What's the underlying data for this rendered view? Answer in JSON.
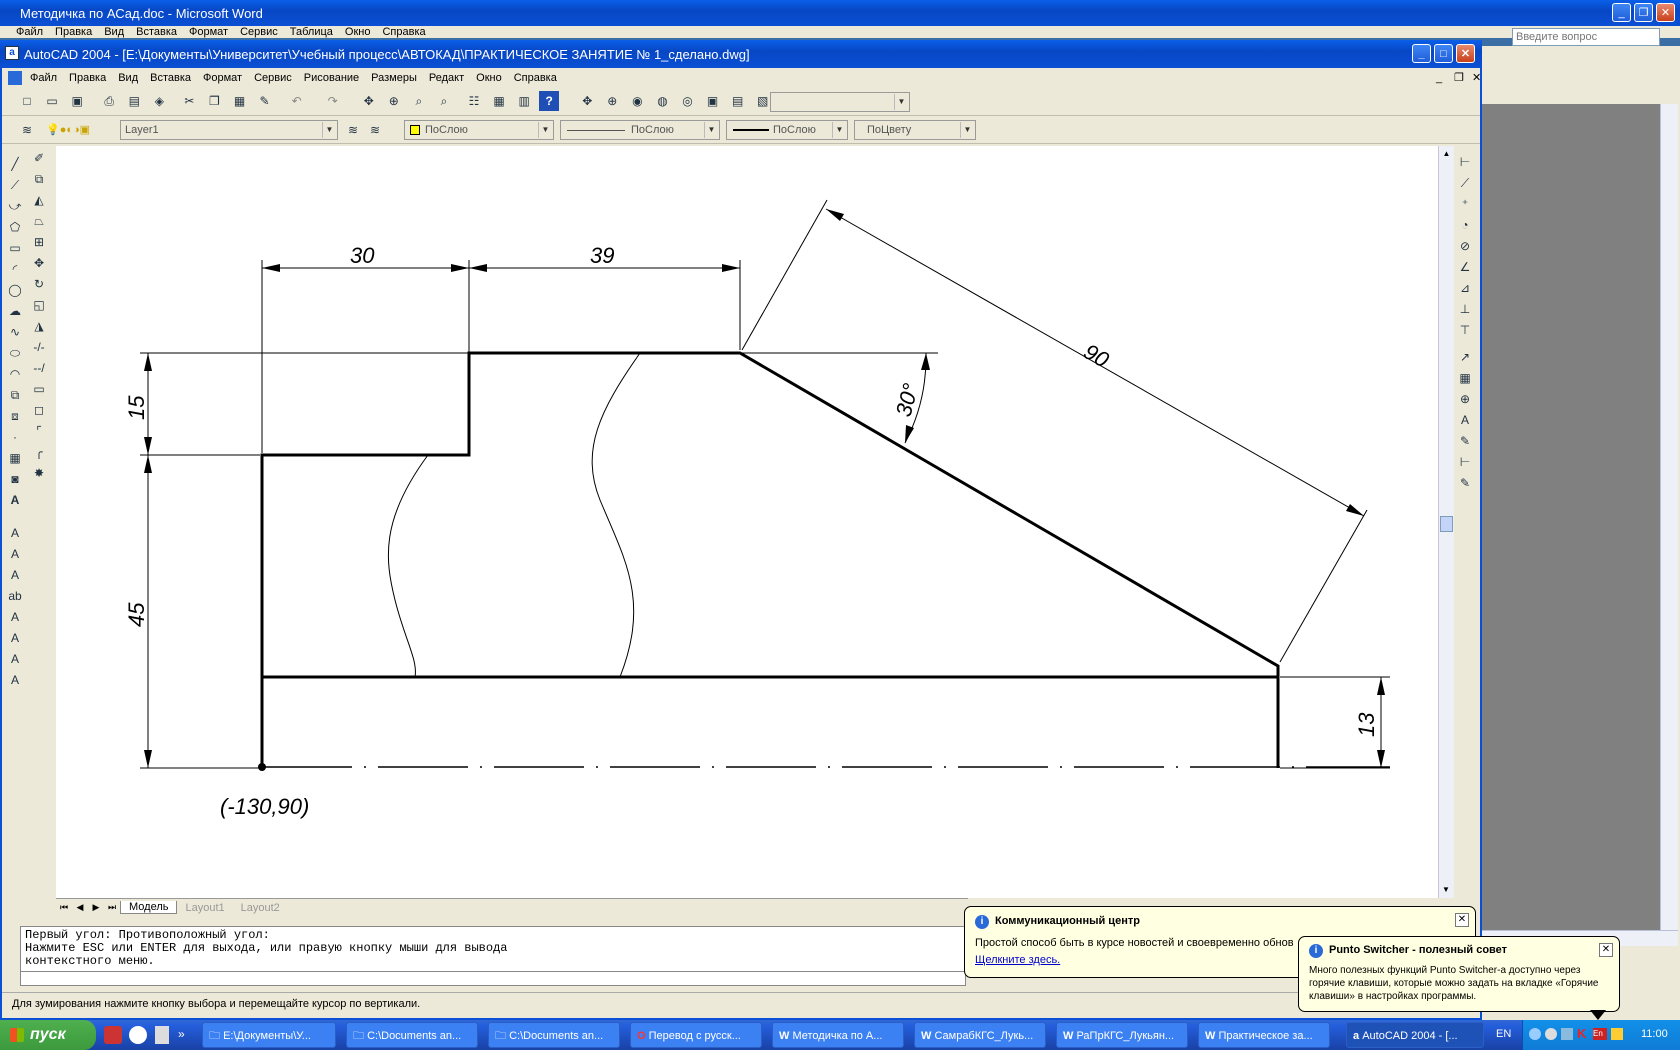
{
  "word": {
    "title": "Методичка по АСад.doc - Microsoft Word",
    "menu": [
      "Файл",
      "Правка",
      "Вид",
      "Вставка",
      "Формат",
      "Сервис",
      "Таблица",
      "Окно",
      "Справка"
    ],
    "question_placeholder": "Введите вопрос"
  },
  "autocad": {
    "title": "AutoCAD 2004 - [E:\\Документы\\Университет\\Учебный процесс\\АВТОКАД\\ПРАКТИЧЕСКОЕ ЗАНЯТИЕ № 1_сделано.dwg]",
    "menu": [
      "Файл",
      "Правка",
      "Вид",
      "Вставка",
      "Формат",
      "Сервис",
      "Рисование",
      "Размеры",
      "Редакт",
      "Окно",
      "Справка"
    ],
    "layer": "Layer1",
    "color": "ПоСлою",
    "linetype": "ПоСлою",
    "lineweight": "ПоСлою",
    "plotstyle": "ПоЦвету",
    "tabs": [
      "Модель",
      "Layout1",
      "Layout2"
    ],
    "command_lines": [
      "Первый угол: Противоположный угол:",
      "Нажмите ESC или ENTER для выхода, или правую кнопку мыши для вывода",
      "контекстного меню."
    ],
    "status": "Для зумирования нажмите кнопку выбора и перемещайте курсор по вертикали."
  },
  "drawing": {
    "dim_30": "30",
    "dim_39": "39",
    "dim_90": "90",
    "dim_15": "15",
    "dim_45": "45",
    "dim_13": "13",
    "dim_angle": "30°",
    "coord": "(-130,90)"
  },
  "balloons": {
    "comm_title": "Коммуникационный центр",
    "comm_text": "Простой способ быть в курсе новостей и своевременно обнов",
    "comm_link": "Щелкните здесь.",
    "punto_title": "Punto Switcher - полезный совет",
    "punto_text": "Много полезных функций Punto Switcher-а доступно через горячие клавиши, которые можно задать на вкладке «Горячие клавиши» в настройках программы."
  },
  "taskbar": {
    "start": "пуск",
    "items": [
      "E:\\Документы\\У...",
      "C:\\Documents an...",
      "C:\\Documents an...",
      "Перевод с русск...",
      "Методичка по А...",
      "СамрабКГС_Лукь...",
      "РаПрКГС_Лукьян...",
      "Практическое за...",
      "AutoCAD 2004 - [..."
    ],
    "lang": "EN",
    "clock": "11:00"
  },
  "colors": {
    "xp_blue": "#0a5fe8",
    "face": "#ece9d8",
    "taskbar": "#245edb",
    "start": "#3c9a3c"
  }
}
